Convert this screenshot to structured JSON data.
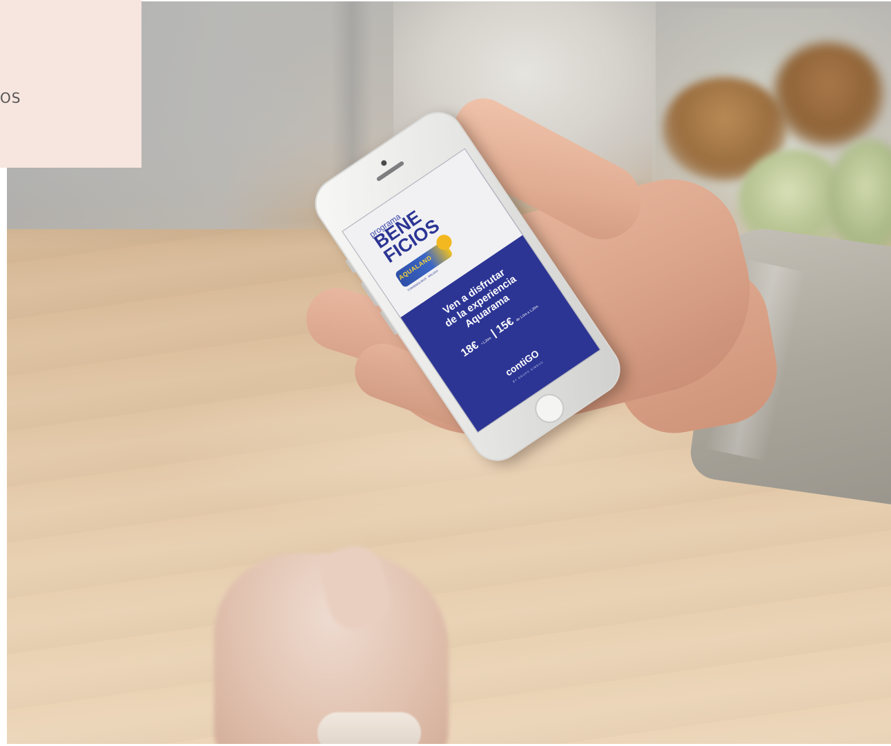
{
  "overlay_panel": {
    "text": "OS",
    "color": "#f7e6df"
  },
  "photo": {
    "phone_screen": {
      "programa": "programa",
      "beneficios_line1": "BENE",
      "beneficios_line2": "FICIOS",
      "logo_text": "AQUALAND",
      "logo_sub": "TORREMOLINOS · MÁLAGA",
      "headline_line1": "Ven a disfrutar",
      "headline_line2": "de la experiencia",
      "headline_line3": "Aquarama",
      "price1": "18€",
      "price1_note": "+1,20m",
      "price2": "15€",
      "price2_note": "de 1,0m a 1,20m",
      "brand": "contiGO",
      "brand_sub": "BY GRUPO SIMEVO",
      "accent_color": "#2c3594"
    }
  }
}
